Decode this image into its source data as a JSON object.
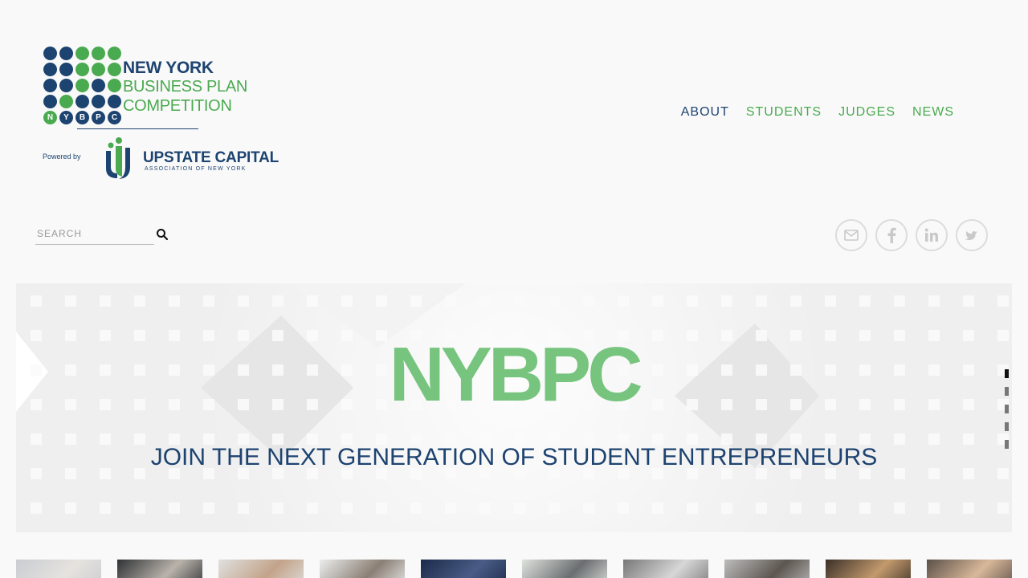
{
  "logo": {
    "dot_letters": [
      "N",
      "Y",
      "B",
      "P",
      "C"
    ],
    "line1": "NEW YORK",
    "line2": "BUSINESS PLAN",
    "line3": "COMPETITION",
    "powered_by": "Powered by",
    "partner_name_bold": "UPSTATE CAPITAL",
    "partner_sub": "ASSOCIATION OF NEW YORK",
    "colors": {
      "navy": "#1d4370",
      "green": "#4aaa4f"
    }
  },
  "nav": {
    "items": [
      {
        "label": "ABOUT",
        "active": true
      },
      {
        "label": "STUDENTS",
        "active": false
      },
      {
        "label": "JUDGES",
        "active": false
      },
      {
        "label": "NEWS",
        "active": false
      }
    ]
  },
  "search": {
    "placeholder": "SEARCH",
    "value": "",
    "icon": "search-icon"
  },
  "social": [
    {
      "name": "email",
      "icon": "mail-icon"
    },
    {
      "name": "facebook",
      "icon": "facebook-icon"
    },
    {
      "name": "linkedin",
      "icon": "linkedin-icon"
    },
    {
      "name": "twitter",
      "icon": "twitter-icon"
    }
  ],
  "hero": {
    "title": "NYBPC",
    "subtitle": "JOIN THE NEXT GENERATION OF STUDENT ENTREPRENEURS",
    "slides_total": 5,
    "active_slide": 1,
    "title_color": "#77c47f"
  },
  "gallery": {
    "thumbnail_count": 10
  }
}
